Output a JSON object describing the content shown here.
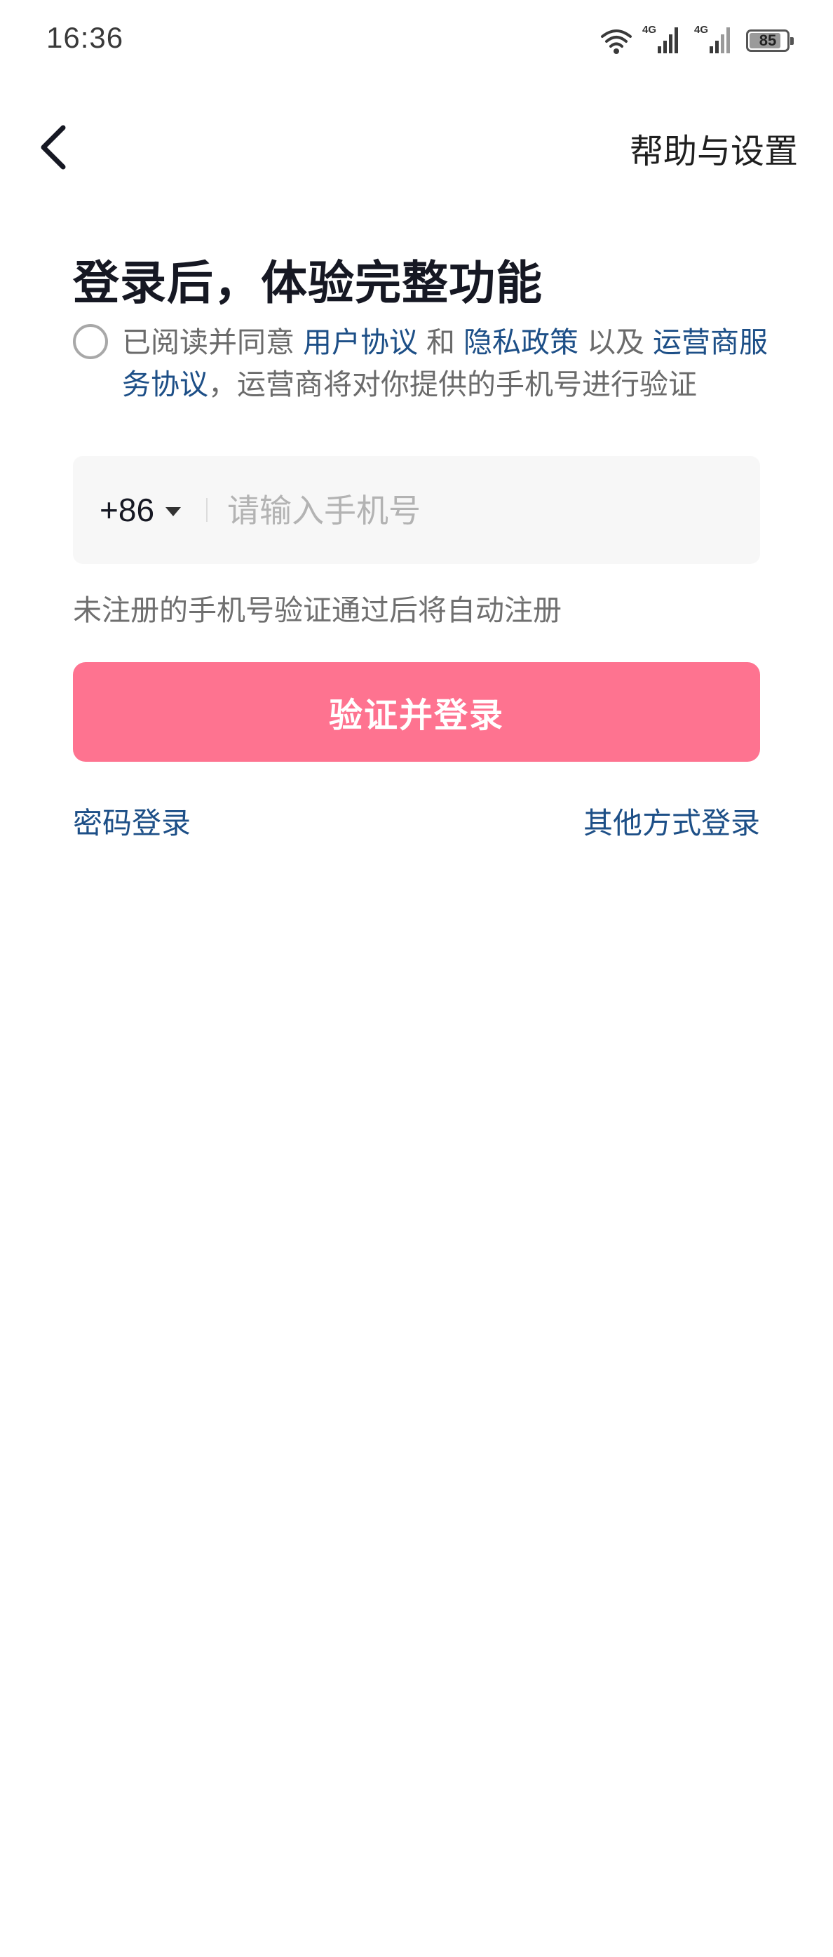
{
  "status_bar": {
    "time": "16:36",
    "network_1": "4G",
    "network_2": "4G",
    "battery_level": "85"
  },
  "nav": {
    "back_icon": "chevron-left-icon",
    "help_label": "帮助与设置"
  },
  "title": "登录后，体验完整功能",
  "agreement": {
    "prefix": "已阅读并同意",
    "user_agreement": "用户协议",
    "and": "和",
    "privacy_policy": "隐私政策",
    "also": "以及",
    "carrier_agreement": "运营商服务协议",
    "suffix": "，运营商将对你提供的手机号进行验证"
  },
  "phone": {
    "country_code": "+86",
    "placeholder": "请输入手机号",
    "value": ""
  },
  "hint": "未注册的手机号验证通过后将自动注册",
  "login_button": "验证并登录",
  "links": {
    "password_login": "密码登录",
    "other_login": "其他方式登录"
  },
  "colors": {
    "accent": "#fe7390",
    "link": "#1d4f87"
  }
}
